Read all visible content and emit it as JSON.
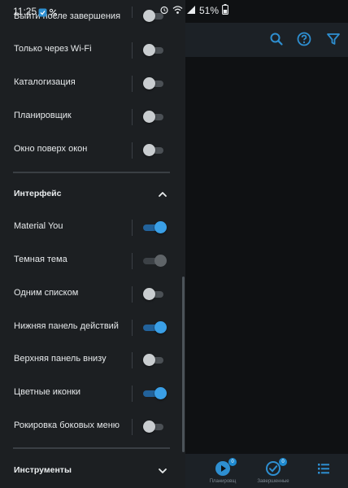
{
  "status_bar": {
    "time": "11:25",
    "battery": "51%"
  },
  "drawer": {
    "top_partial_label": "Выйти после завершения",
    "general_items": [
      {
        "label": "Только через Wi-Fi",
        "state": "off"
      },
      {
        "label": "Каталогизация",
        "state": "off"
      },
      {
        "label": "Планировщик",
        "state": "off"
      },
      {
        "label": "Окно поверх окон",
        "state": "off"
      }
    ],
    "interface_section": {
      "title": "Интерфейс",
      "expanded": true,
      "items": [
        {
          "label": "Material You",
          "state": "on"
        },
        {
          "label": "Темная тема",
          "state": "disabled-on"
        },
        {
          "label": "Одним списком",
          "state": "off"
        },
        {
          "label": "Нижняя панель действий",
          "state": "on"
        },
        {
          "label": "Верхняя панель внизу",
          "state": "off"
        },
        {
          "label": "Цветные иконки",
          "state": "on"
        },
        {
          "label": "Рокировка боковых меню",
          "state": "off"
        }
      ]
    },
    "tools_section": {
      "title": "Инструменты",
      "expanded": false
    }
  },
  "app_bottom_nav": {
    "items": [
      {
        "label": "Планировщ",
        "badge": "0",
        "icon": "play-circle-icon"
      },
      {
        "label": "Завершенные",
        "badge": "0",
        "icon": "check-circle-icon"
      },
      {
        "label": "",
        "icon": "list-icon"
      }
    ]
  },
  "colors": {
    "accent": "#3a9fe6",
    "drawer_bg": "#1c1f22",
    "toolbar_bg": "#1c2126"
  }
}
